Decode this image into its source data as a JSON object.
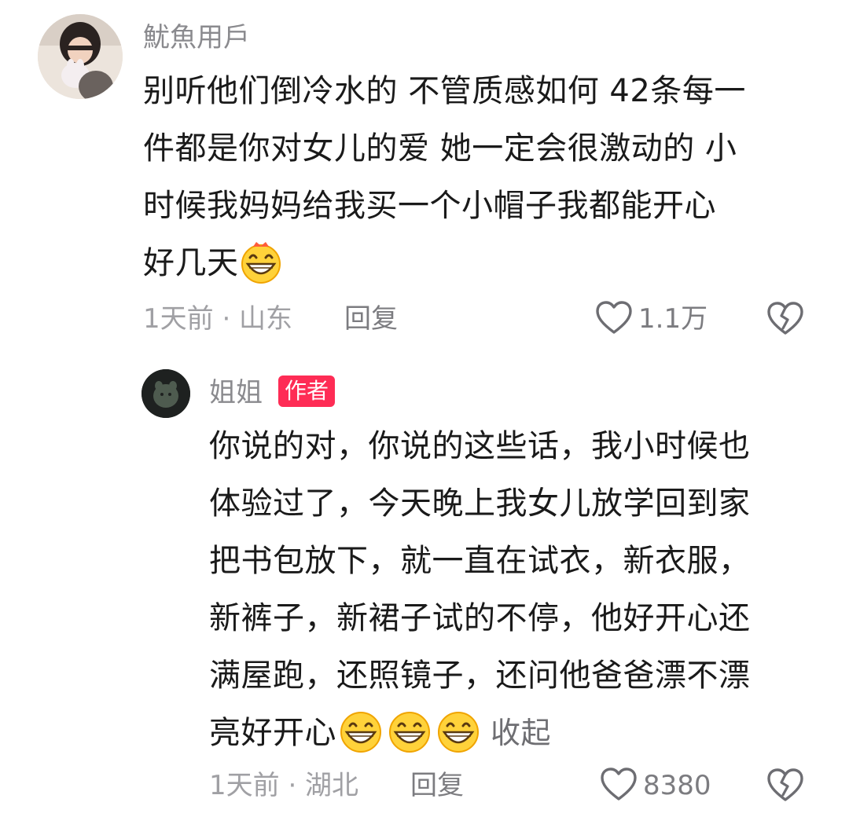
{
  "comment": {
    "username": "魷魚用戶",
    "text_lines": [
      "别听他们倒冷水的 不管质感如何 42条每一",
      "件都是你对女儿的爱 她一定会很激动的 小",
      "时候我妈妈给我买一个小帽子我都能开心",
      "好几天"
    ],
    "emoji": "grinning-face-emoji",
    "time_location": "1天前 · 山东",
    "reply_label": "回复",
    "like_count": "1.1万"
  },
  "reply": {
    "username": "姐姐",
    "badge": "作者",
    "text_lines": [
      "你说的对，你说的这些话，我小时候也",
      "体验过了，今天晚上我女儿放学回到家",
      "把书包放下，就一直在试衣，新衣服，",
      "新裤子，新裙子试的不停，他好开心还",
      "满屋跑，还照镜子，还问他爸爸漂不漂",
      "亮好开心"
    ],
    "emoji": "grinning-face-emoji",
    "collapse_label": "收起",
    "time_location": "1天前 · 湖北",
    "reply_label": "回复",
    "like_count": "8380"
  },
  "colors": {
    "badge": "#fe2c55",
    "muted_text": "#8a8a8e",
    "body_text": "#1a1a1a"
  },
  "icons": {
    "like": "heart-outline-icon",
    "dislike": "broken-heart-icon"
  }
}
